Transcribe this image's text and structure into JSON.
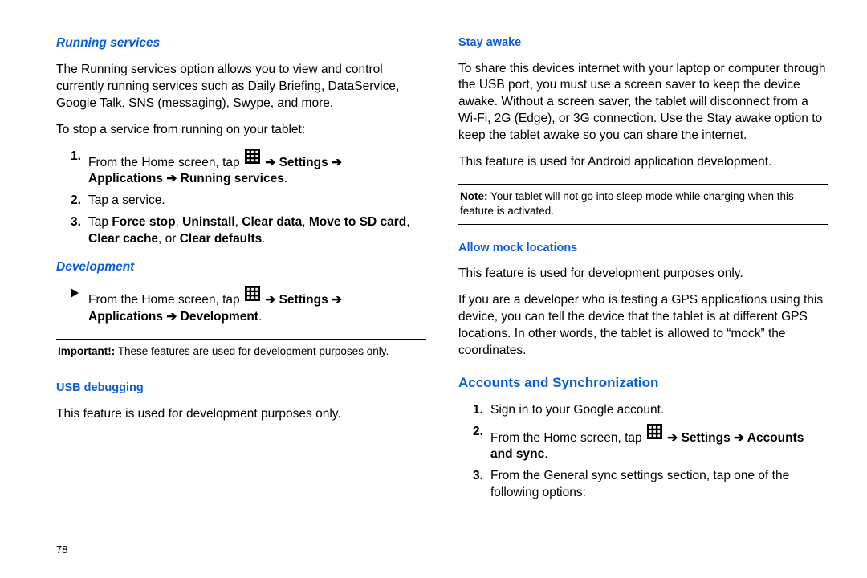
{
  "page_number": "78",
  "arrow": "➔",
  "left": {
    "running_services": {
      "heading": "Running services",
      "intro": "The Running services option allows you to view and control currently running services such as Daily Briefing, DataService, Google Talk, SNS (messaging), Swype, and more.",
      "lead": "To stop a service from running on your tablet:",
      "step1_a": "From the Home screen, tap ",
      "step1_b": " Settings ",
      "step1_c": "Applications ",
      "step1_d": " Running services",
      "step2": "Tap a service.",
      "step3_a": "Tap ",
      "step3_force": "Force stop",
      "step3_uninstall": "Uninstall",
      "step3_clear_data": "Clear data",
      "step3_move": "Move to SD card",
      "step3_clear_cache": "Clear cache",
      "step3_or": ", or ",
      "step3_clear_defaults": "Clear defaults",
      "comma": ", "
    },
    "development": {
      "heading": "Development",
      "step_a": "From the Home screen, tap ",
      "step_b": " Settings ",
      "step_c": "Applications ",
      "step_d": " Development"
    },
    "important_box": {
      "lead": "Important!:",
      "body": " These features are used for development purposes only."
    },
    "usb_debugging": {
      "heading": "USB debugging",
      "body": "This feature is used for development purposes only."
    }
  },
  "right": {
    "stay_awake": {
      "heading": "Stay awake",
      "body1": "To share this devices internet with your laptop or computer through the USB port, you must use a screen saver to keep the device awake. Without a screen saver, the tablet will disconnect from a Wi-Fi, 2G (Edge), or 3G connection. Use the Stay awake option to keep the tablet awake so you can share the internet.",
      "body2": "This feature is used for Android application development."
    },
    "note_box": {
      "lead": "Note:",
      "body": " Your tablet will not go into sleep mode while charging when this feature is activated."
    },
    "allow_mock": {
      "heading": "Allow mock locations",
      "body1": "This feature is used for development purposes only.",
      "body2": "If you are a developer who is testing a GPS applications using this device, you can tell the device that the tablet is at different GPS locations. In other words, the tablet is allowed to “mock” the coordinates."
    },
    "accounts": {
      "heading": "Accounts and Synchronization",
      "step1": "Sign in to your Google account.",
      "step2_a": "From the Home screen, tap ",
      "step2_b": " Settings ",
      "step2_c": " Accounts and sync",
      "step3": "From the General sync settings section, tap one of the following options:"
    }
  }
}
